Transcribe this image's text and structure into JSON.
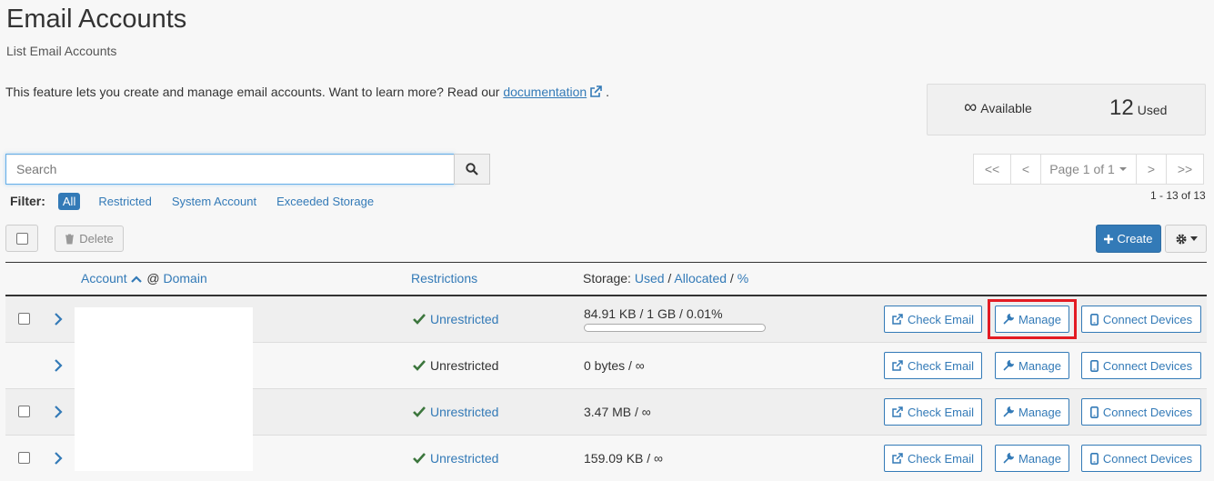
{
  "header": {
    "title": "Email Accounts",
    "subtitle": "List Email Accounts",
    "description_prefix": "This feature lets you create and manage email accounts. Want to learn more? Read our",
    "doc_link": "documentation",
    "description_suffix": "."
  },
  "stats": {
    "available_value": "∞",
    "available_label": "Available",
    "used_value": "12",
    "used_label": "Used"
  },
  "search": {
    "placeholder": "Search"
  },
  "filter": {
    "label": "Filter:",
    "items": [
      "All",
      "Restricted",
      "System Account",
      "Exceeded Storage"
    ],
    "active": "All"
  },
  "pagination": {
    "first": "<<",
    "prev": "<",
    "page_label": "Page 1 of 1",
    "next": ">",
    "last": ">>",
    "range": "1 - 13 of 13"
  },
  "toolbar": {
    "delete_label": "Delete",
    "create_label": "Create"
  },
  "table": {
    "columns": {
      "account": "Account",
      "at": "@",
      "domain": "Domain",
      "restrictions": "Restrictions",
      "storage_prefix": "Storage:",
      "used": "Used",
      "allocated": "Allocated",
      "percent": "%"
    },
    "rows": [
      {
        "restriction": "Unrestricted",
        "storage": "84.91 KB / 1 GB / 0.01%",
        "has_checkbox": true,
        "has_bar": true,
        "bar_fraction": 0.0001
      },
      {
        "restriction": "Unrestricted",
        "storage": "0 bytes / ∞",
        "has_checkbox": false,
        "has_bar": false
      },
      {
        "restriction": "Unrestricted",
        "storage": "3.47 MB / ∞",
        "has_checkbox": true,
        "has_bar": false
      },
      {
        "restriction": "Unrestricted",
        "storage": "159.09 KB / ∞",
        "has_checkbox": true,
        "has_bar": false
      }
    ],
    "actions": {
      "check_email": "Check Email",
      "manage": "Manage",
      "connect_devices": "Connect Devices"
    }
  },
  "colors": {
    "accent": "#337ab7",
    "success": "#3c763d",
    "highlight": "#e31b23"
  }
}
